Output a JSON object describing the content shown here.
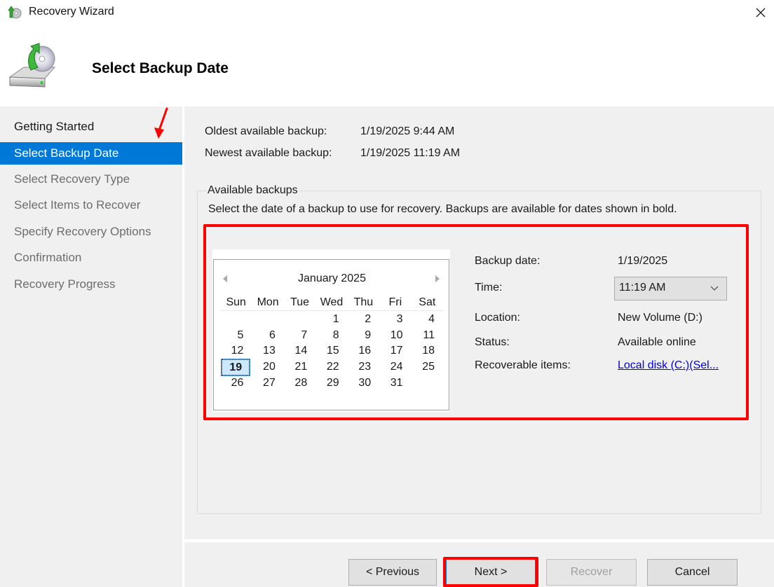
{
  "window": {
    "title": "Recovery Wizard",
    "app_icon": "recovery-wizard-icon",
    "close_icon": "close-icon"
  },
  "header": {
    "title": "Select Backup Date",
    "icon": "backup-drive-restore-icon"
  },
  "sidebar": {
    "steps": [
      {
        "label": "Getting Started",
        "state": "done"
      },
      {
        "label": "Select Backup Date",
        "state": "active"
      },
      {
        "label": "Select Recovery Type",
        "state": "pending"
      },
      {
        "label": "Select Items to Recover",
        "state": "pending"
      },
      {
        "label": "Specify Recovery Options",
        "state": "pending"
      },
      {
        "label": "Confirmation",
        "state": "pending"
      },
      {
        "label": "Recovery Progress",
        "state": "pending"
      }
    ]
  },
  "summary": {
    "oldest_label": "Oldest available backup:",
    "oldest_value": "1/19/2025 9:44 AM",
    "newest_label": "Newest available backup:",
    "newest_value": "1/19/2025 11:19 AM"
  },
  "available_backups": {
    "legend": "Available backups",
    "description": "Select the date of a backup to use for recovery. Backups are available for dates shown in bold."
  },
  "calendar": {
    "month_label": "January 2025",
    "prev_icon": "triangle-left-icon",
    "next_icon": "triangle-right-icon",
    "weekdays": [
      "Sun",
      "Mon",
      "Tue",
      "Wed",
      "Thu",
      "Fri",
      "Sat"
    ],
    "leading_blanks": 3,
    "days_in_month": 31,
    "selected_day": 19,
    "bold_days": [
      19
    ]
  },
  "details": {
    "backup_date_label": "Backup date:",
    "backup_date_value": "1/19/2025",
    "time_label": "Time:",
    "time_value": "11:19 AM",
    "location_label": "Location:",
    "location_value": "New Volume (D:)",
    "status_label": "Status:",
    "status_value": "Available online",
    "recoverable_label": "Recoverable items:",
    "recoverable_value": "Local disk (C:)(Sel..."
  },
  "buttons": {
    "previous": "< Previous",
    "next": "Next >",
    "recover": "Recover",
    "cancel": "Cancel"
  },
  "annotations": {
    "highlight_color": "#ff0000",
    "accent_color": "#0078d7"
  }
}
